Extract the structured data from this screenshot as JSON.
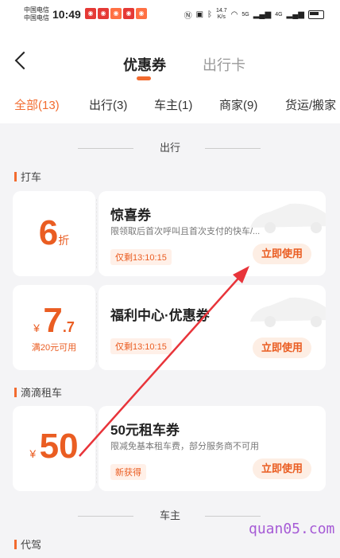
{
  "status_bar": {
    "carrier_1": "中国电信",
    "carrier_2": "中国电信",
    "time": "10:49",
    "net_speed_value": "14.7",
    "net_speed_unit": "K/s",
    "signal_1_label": "5G",
    "signal_2_label": "4G"
  },
  "header": {
    "tabs": [
      {
        "label": "优惠券",
        "active": true
      },
      {
        "label": "出行卡",
        "active": false
      }
    ]
  },
  "filters": [
    {
      "label": "全部(13)",
      "active": true
    },
    {
      "label": "出行(3)",
      "active": false
    },
    {
      "label": "车主(1)",
      "active": false
    },
    {
      "label": "商家(9)",
      "active": false
    },
    {
      "label": "货运/搬家",
      "active": false
    }
  ],
  "sections": [
    {
      "title": "出行"
    },
    {
      "title": "车主"
    }
  ],
  "subcategories": [
    "打车",
    "滴滴租车",
    "代驾"
  ],
  "coupons": [
    {
      "amount": "6",
      "unit": "折",
      "title": "惊喜券",
      "desc": "限领取后首次呼叫且首次支付的快车/...",
      "tag": "仅剩13:10:15",
      "button": "立即使用"
    },
    {
      "currency": "¥",
      "amount": "7",
      "decimal": ".7",
      "condition": "满20元可用",
      "title": "福利中心·优惠券",
      "desc": "",
      "tag": "仅剩13:10:15",
      "button": "立即使用"
    },
    {
      "currency": "¥",
      "amount": "50",
      "title": "50元租车券",
      "desc": "限减免基本租车费，部分服务商不可用",
      "tag": "新获得",
      "button": "立即使用"
    }
  ],
  "colors": {
    "accent": "#ea5d22",
    "arrow": "#e8343a",
    "watermark": "#a65bd6"
  },
  "watermark": "quan05.com"
}
